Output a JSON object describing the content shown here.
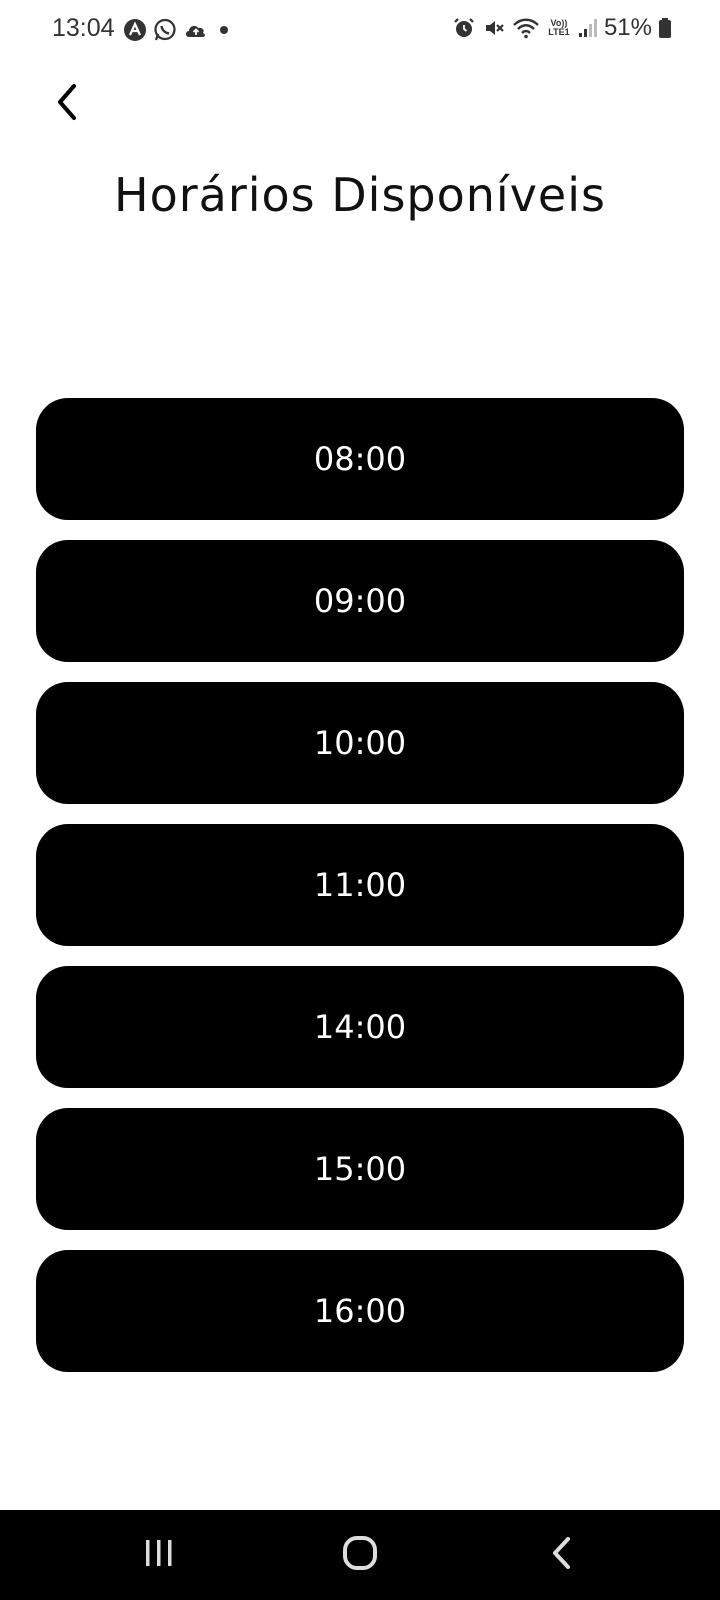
{
  "status_bar": {
    "time": "13:04",
    "battery_percent": "51%",
    "network_label": "LTE1",
    "volte_label": "Vo))",
    "icons_left": [
      "app-a-icon",
      "whatsapp-icon",
      "cloud-upload-icon",
      "dot-icon"
    ],
    "icons_right": [
      "alarm-icon",
      "mute-icon",
      "wifi-icon",
      "volte-icon",
      "signal-icon",
      "battery-icon"
    ]
  },
  "header": {
    "back_icon": "chevron-left-icon",
    "title": "Horários Disponíveis"
  },
  "slots": [
    {
      "label": "08:00"
    },
    {
      "label": "09:00"
    },
    {
      "label": "10:00"
    },
    {
      "label": "11:00"
    },
    {
      "label": "14:00"
    },
    {
      "label": "15:00"
    },
    {
      "label": "16:00"
    }
  ],
  "nav_bar": {
    "items": [
      "recents-icon",
      "home-icon",
      "back-icon"
    ]
  },
  "colors": {
    "slot_background": "#000000",
    "slot_text": "#ffffff",
    "page_background": "#ffffff",
    "nav_background": "#000000"
  }
}
